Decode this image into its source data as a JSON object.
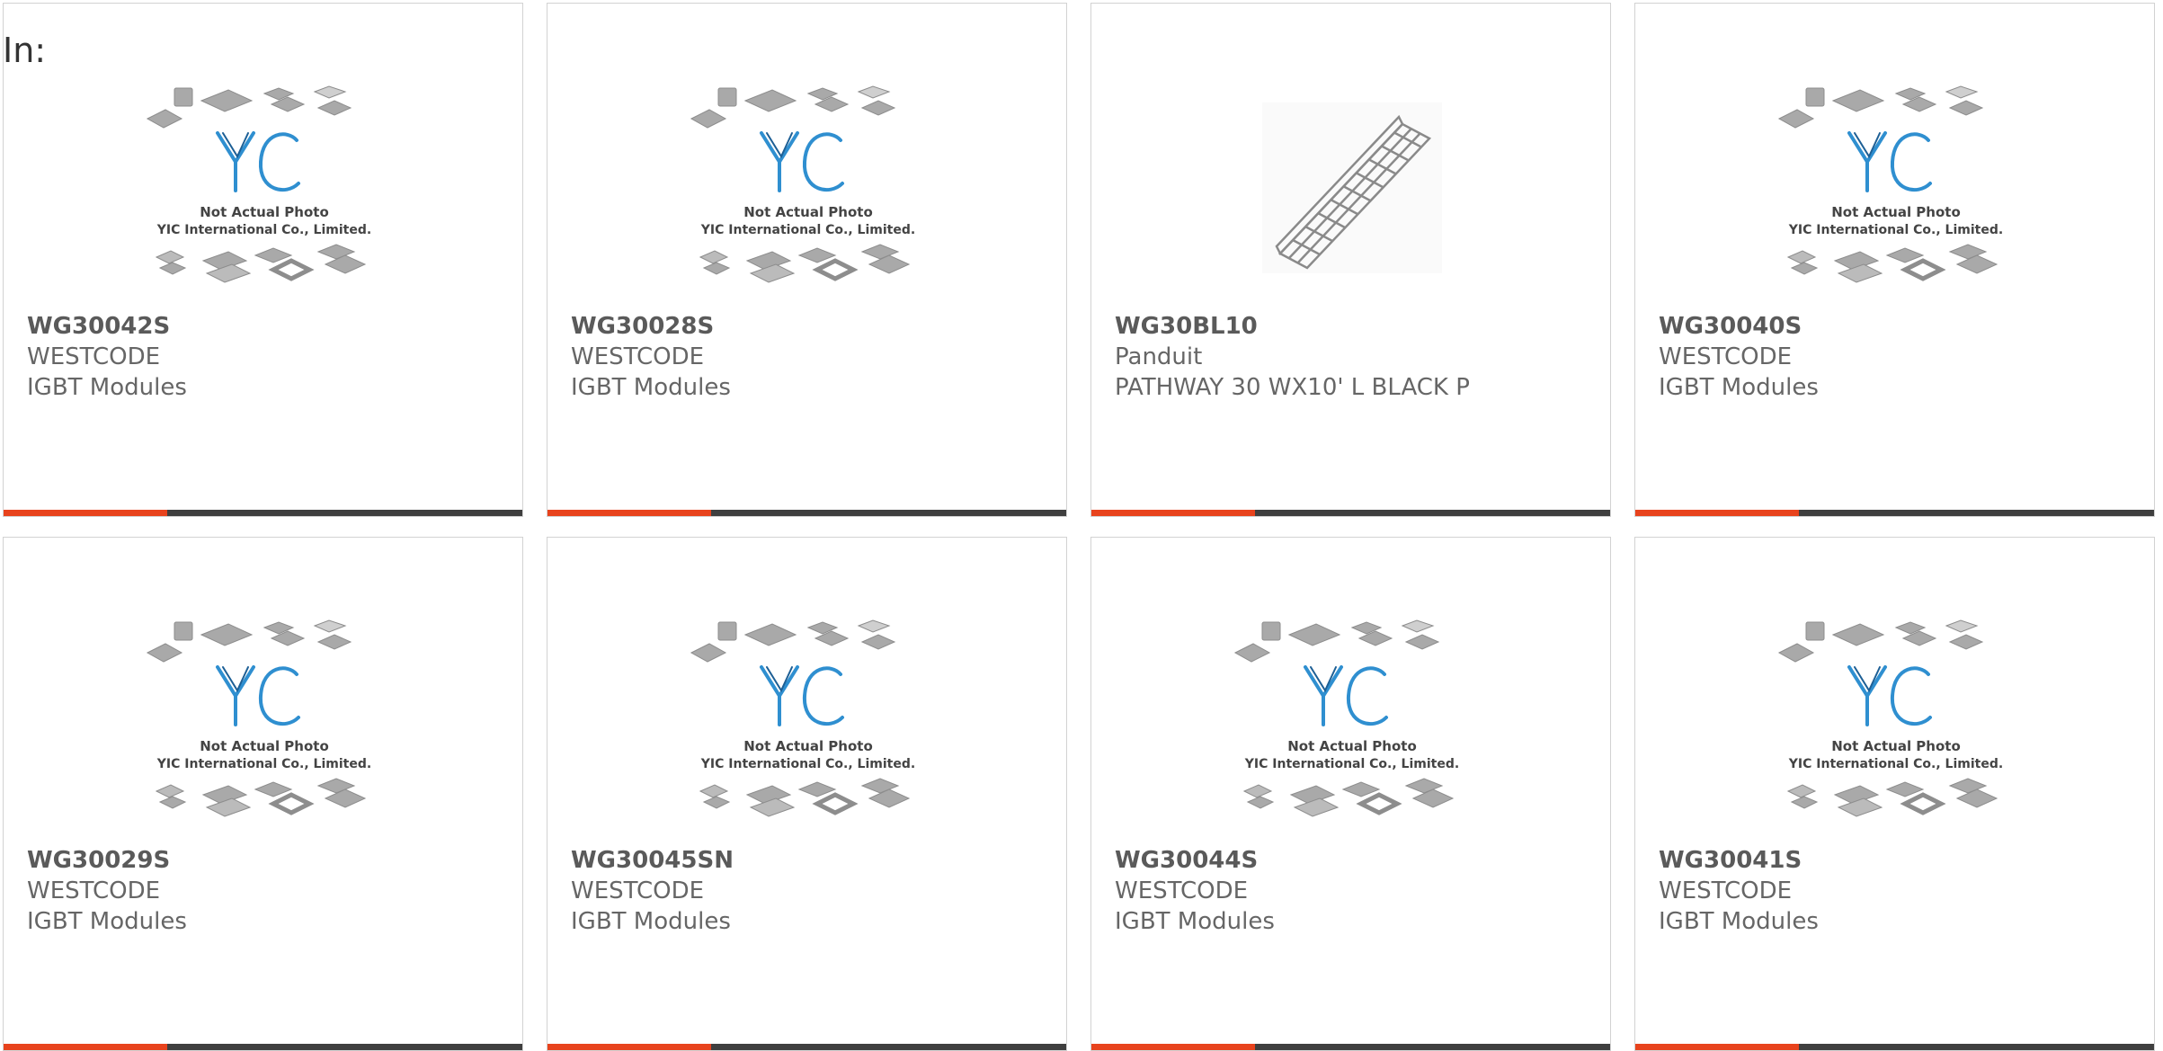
{
  "heading": "In:",
  "colors": {
    "accent": "#e8431d",
    "bar": "#3f3f3f",
    "border": "#d2d2d2",
    "text": "#666666",
    "logo_blue": "#2f8fd0"
  },
  "placeholder": {
    "line1": "Not Actual Photo",
    "line2": "YIC International Co., Limited."
  },
  "products": [
    {
      "part": "WG30042S",
      "maker": "WESTCODE",
      "desc": "IGBT Modules",
      "image": "placeholder-yic"
    },
    {
      "part": "WG30028S",
      "maker": "WESTCODE",
      "desc": "IGBT Modules",
      "image": "placeholder-yic"
    },
    {
      "part": "WG30BL10",
      "maker": "Panduit",
      "desc": "PATHWAY 30 WX10' L BLACK P",
      "image": "wire-basket-tray"
    },
    {
      "part": "WG30040S",
      "maker": "WESTCODE",
      "desc": "IGBT Modules",
      "image": "placeholder-yic"
    },
    {
      "part": "WG30029S",
      "maker": "WESTCODE",
      "desc": "IGBT Modules",
      "image": "placeholder-yic"
    },
    {
      "part": "WG30045SN",
      "maker": "WESTCODE",
      "desc": "IGBT Modules",
      "image": "placeholder-yic"
    },
    {
      "part": "WG30044S",
      "maker": "WESTCODE",
      "desc": "IGBT Modules",
      "image": "placeholder-yic"
    },
    {
      "part": "WG30041S",
      "maker": "WESTCODE",
      "desc": "IGBT Modules",
      "image": "placeholder-yic"
    }
  ]
}
